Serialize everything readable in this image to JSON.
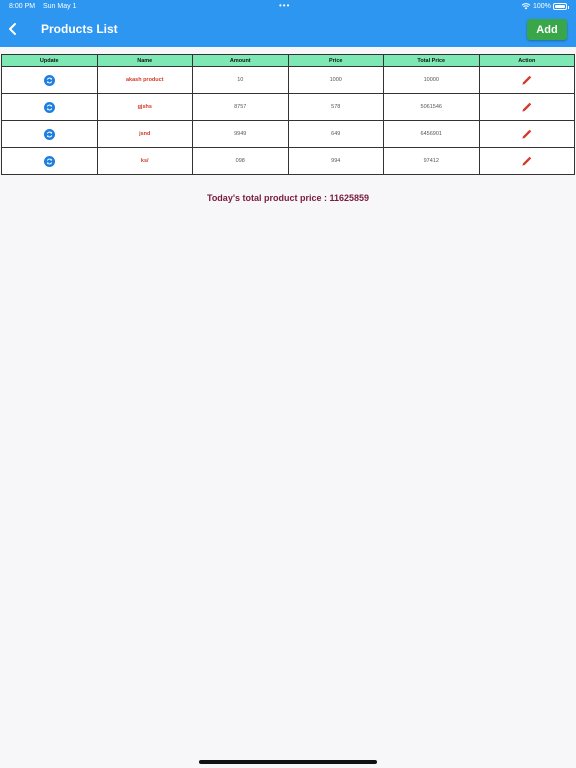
{
  "status_bar": {
    "time": "8:00 PM",
    "date": "Sun May 1",
    "dots": "•••",
    "battery": "100%"
  },
  "header": {
    "title": "Products List",
    "add_label": "Add",
    "back_icon": "chevron-left-icon"
  },
  "table": {
    "columns": [
      "Update",
      "Name",
      "Amount",
      "Price",
      "Total Price",
      "Action"
    ],
    "rows": [
      {
        "name": "akash product",
        "amount": "10",
        "price": "1000",
        "total": "10000"
      },
      {
        "name": "gjshs",
        "amount": "8757",
        "price": "578",
        "total": "5061546"
      },
      {
        "name": "jsnd",
        "amount": "9949",
        "price": "649",
        "total": "6456901"
      },
      {
        "name": "ks/",
        "amount": "098",
        "price": "994",
        "total": "97412"
      }
    ],
    "update_icon": "refresh-icon",
    "action_icon": "pencil-icon"
  },
  "summary": {
    "text": "Today's total product price : 11625859"
  },
  "colors": {
    "appbar": "#2d96f0",
    "add_button": "#3aa64a",
    "header_row": "#7de8b4",
    "name_text": "#d23a2a",
    "summary_text": "#7a1a3a"
  }
}
